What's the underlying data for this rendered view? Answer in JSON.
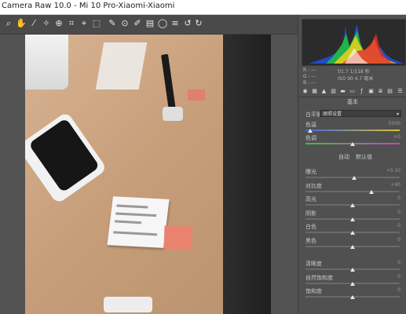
{
  "window": {
    "title": "Camera Raw 10.0 -  Mi 10 Pro-Xiaomi-Xiaomi"
  },
  "toolbar": {
    "tools": [
      {
        "name": "zoom-tool-icon",
        "glyph": "⌕"
      },
      {
        "name": "hand-tool-icon",
        "glyph": "✋"
      },
      {
        "name": "white-balance-tool-icon",
        "glyph": "⁄"
      },
      {
        "name": "color-sampler-icon",
        "glyph": "✧"
      },
      {
        "name": "targeted-adjust-icon",
        "glyph": "⊕"
      },
      {
        "name": "crop-tool-icon",
        "glyph": "⌗"
      },
      {
        "name": "straighten-tool-icon",
        "glyph": "⌖"
      },
      {
        "name": "transform-tool-icon",
        "glyph": "⬚"
      },
      {
        "name": "spot-removal-icon",
        "glyph": "✎"
      },
      {
        "name": "red-eye-icon",
        "glyph": "⊙"
      },
      {
        "name": "adjustment-brush-icon",
        "glyph": "✐"
      },
      {
        "name": "graduated-filter-icon",
        "glyph": "▤"
      },
      {
        "name": "radial-filter-icon",
        "glyph": "◯"
      },
      {
        "name": "preferences-icon",
        "glyph": "≡"
      },
      {
        "name": "rotate-left-icon",
        "glyph": "↺"
      },
      {
        "name": "rotate-right-icon",
        "glyph": "↻"
      }
    ],
    "fullscreen_glyph": "⇱"
  },
  "histogram": {
    "r_label": "R :",
    "g_label": "G :",
    "b_label": "B :",
    "r_value": "---",
    "g_value": "---",
    "b_value": "---",
    "aperture_shutter": "f/1.7   1/118 秒",
    "iso_focal": "ISO 90   4.7 毫米"
  },
  "panel": {
    "section_title": "基本",
    "white_balance_label": "白平衡:",
    "white_balance_value": "原照设置",
    "temp_label": "色温",
    "temp_value": "5000",
    "tint_label": "色调",
    "tint_value": "+0",
    "auto_label": "自动",
    "default_label": "默认值",
    "sliders": [
      {
        "label": "曝光",
        "value": "+0.10",
        "level": 0.52
      },
      {
        "label": "对比度",
        "value": "+40",
        "level": 0.7
      },
      {
        "label": "高光",
        "value": "0",
        "level": 0.5
      },
      {
        "label": "阴影",
        "value": "0",
        "level": 0.5
      },
      {
        "label": "白色",
        "value": "0",
        "level": 0.5
      },
      {
        "label": "黑色",
        "value": "0",
        "level": 0.5
      },
      {
        "label": "清晰度",
        "value": "0",
        "level": 0.5
      },
      {
        "label": "自然饱和度",
        "value": "0",
        "level": 0.5
      },
      {
        "label": "饱和度",
        "value": "0",
        "level": 0.5
      }
    ],
    "temp_level": 0.05,
    "tint_level": 0.5
  },
  "colors": {
    "accent": "#e9836f",
    "panel_bg": "#505050",
    "toolbar_bg": "#4a4a4a"
  }
}
